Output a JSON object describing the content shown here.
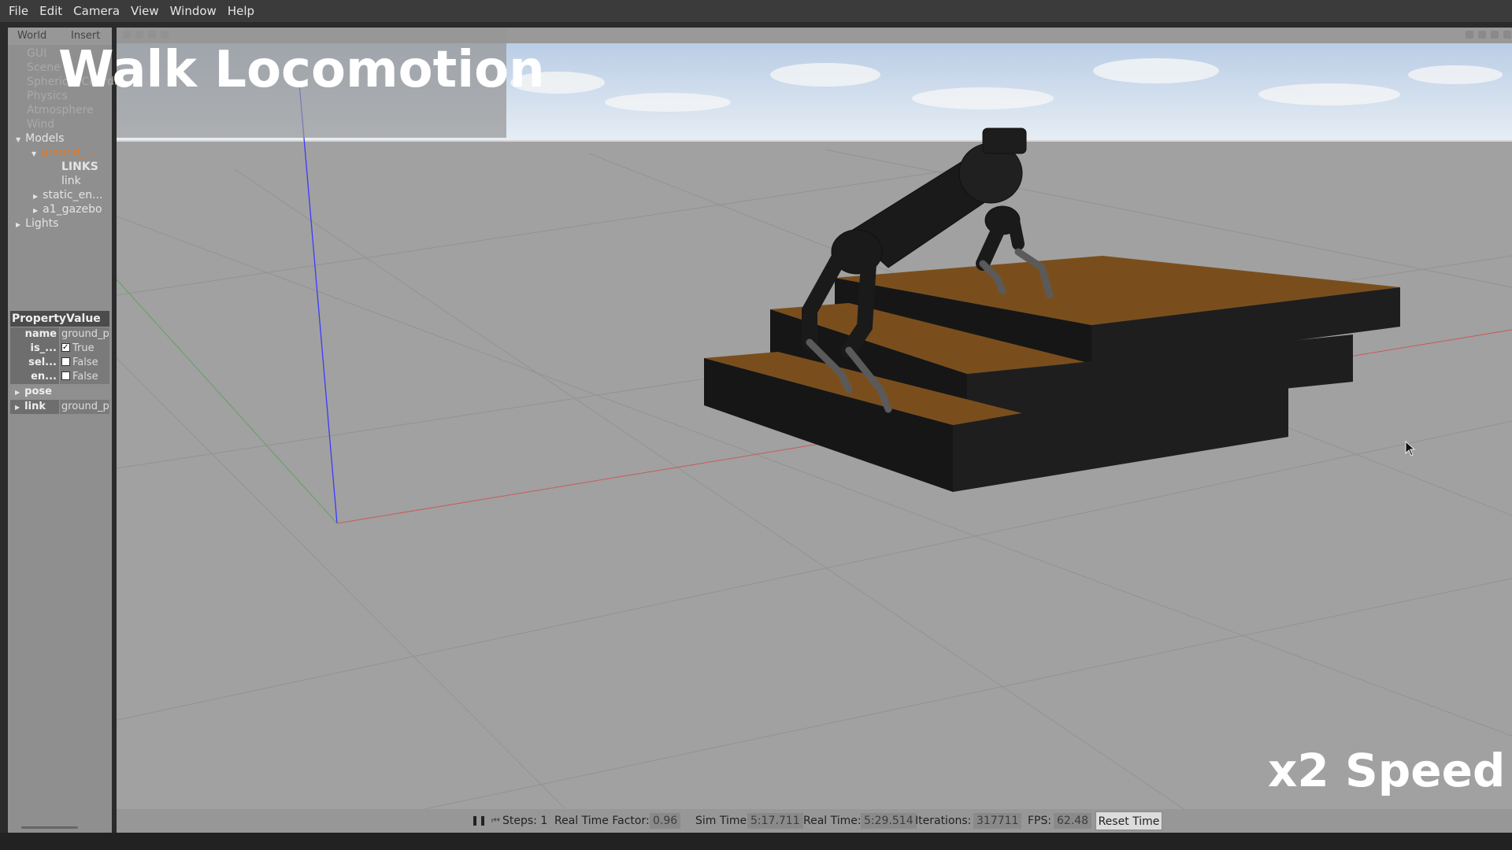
{
  "menu": {
    "items": [
      {
        "label": "File"
      },
      {
        "label": "Edit"
      },
      {
        "label": "Camera"
      },
      {
        "label": "View"
      },
      {
        "label": "Window"
      },
      {
        "label": "Help"
      }
    ]
  },
  "left_panel": {
    "tabs": {
      "world": "World",
      "insert": "Insert"
    },
    "tree": {
      "gui": "GUI",
      "scene": "Scene",
      "spherical": "Spherical Coordinates",
      "physics": "Physics",
      "atmosphere": "Atmosphere",
      "wind": "Wind",
      "models": "Models",
      "ground": "ground_...",
      "links": "LINKS",
      "link": "link",
      "static_env": "static_en...",
      "a1_gazebo": "a1_gazebo",
      "lights": "Lights"
    },
    "properties": {
      "header": "PropertyValue",
      "rows": [
        {
          "key": "name",
          "value": "ground_p"
        },
        {
          "key": "is_...",
          "value": "True",
          "checked": true
        },
        {
          "key": "sel...",
          "value": "False",
          "checked": false
        },
        {
          "key": "en...",
          "value": "False",
          "checked": false
        },
        {
          "key": "pose",
          "value": ""
        },
        {
          "key": "link",
          "value": "ground_p"
        }
      ]
    }
  },
  "overlay": {
    "title": "Walk Locomotion",
    "speed": "x2 Speed"
  },
  "statusbar": {
    "pause_icon": "pause-icon",
    "steps_label": "Steps: 1",
    "rtf_label": "Real Time Factor:",
    "rtf_value": "0.96",
    "sim_time_label": "Sim Time:",
    "sim_time_value": "5:17.711",
    "real_time_label": "Real Time:",
    "real_time_value": "5:29.514",
    "iterations_label": "Iterations:",
    "iterations_value": "317711",
    "fps_label": "FPS:",
    "fps_value": "62.48",
    "reset_label": "Reset Time"
  },
  "colors": {
    "ground": "#a0a0a0",
    "stair_top": "#7a4e1c",
    "stair_side": "#1c1c1c",
    "robot": "#1a1a1a",
    "sky": "#c9d9ec"
  }
}
